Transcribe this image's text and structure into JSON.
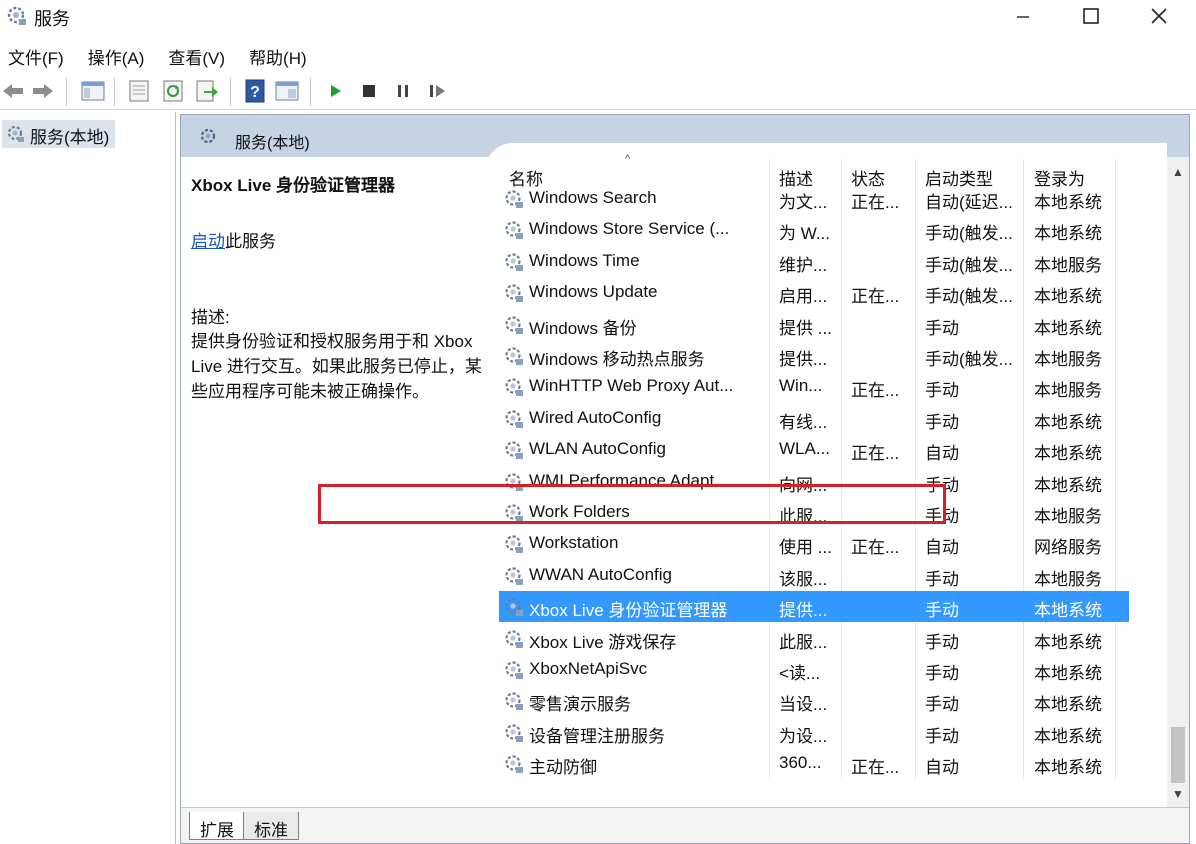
{
  "window": {
    "title": "服务"
  },
  "menu": [
    "文件(F)",
    "操作(A)",
    "查看(V)",
    "帮助(H)"
  ],
  "tree": {
    "root_label": "服务(本地)"
  },
  "pane": {
    "header_title": "服务(本地)",
    "detail": {
      "title": "Xbox Live 身份验证管理器",
      "start_link": "启动",
      "start_suffix": "此服务",
      "desc_label": "描述:",
      "desc_text": "提供身份验证和授权服务用于和 Xbox Live 进行交互。如果此服务已停止，某些应用程序可能未被正确操作。"
    },
    "columns": [
      "名称",
      "描述",
      "状态",
      "启动类型",
      "登录为"
    ],
    "rows": [
      [
        "Windows Search",
        "为文...",
        "正在...",
        "自动(延迟...",
        "本地系统"
      ],
      [
        "Windows Store Service (...",
        "为 W...",
        "",
        "手动(触发...",
        "本地系统"
      ],
      [
        "Windows Time",
        "维护...",
        "",
        "手动(触发...",
        "本地服务"
      ],
      [
        "Windows Update",
        "启用...",
        "正在...",
        "手动(触发...",
        "本地系统"
      ],
      [
        "Windows 备份",
        "提供 ...",
        "",
        "手动",
        "本地系统"
      ],
      [
        "Windows 移动热点服务",
        "提供...",
        "",
        "手动(触发...",
        "本地服务"
      ],
      [
        "WinHTTP Web Proxy Aut...",
        "Win...",
        "正在...",
        "手动",
        "本地服务"
      ],
      [
        "Wired AutoConfig",
        "有线...",
        "",
        "手动",
        "本地系统"
      ],
      [
        "WLAN AutoConfig",
        "WLA...",
        "正在...",
        "自动",
        "本地系统"
      ],
      [
        "WMI Performance Adapt...",
        "向网...",
        "",
        "手动",
        "本地系统"
      ],
      [
        "Work Folders",
        "此服...",
        "",
        "手动",
        "本地服务"
      ],
      [
        "Workstation",
        "使用 ...",
        "正在...",
        "自动",
        "网络服务"
      ],
      [
        "WWAN AutoConfig",
        "该服...",
        "",
        "手动",
        "本地服务"
      ],
      [
        "Xbox Live 身份验证管理器",
        "提供...",
        "",
        "手动",
        "本地系统"
      ],
      [
        "Xbox Live 游戏保存",
        "此服...",
        "",
        "手动",
        "本地系统"
      ],
      [
        "XboxNetApiSvc",
        "<读...",
        "",
        "手动",
        "本地系统"
      ],
      [
        "零售演示服务",
        "当设...",
        "",
        "手动",
        "本地系统"
      ],
      [
        "设备管理注册服务",
        "为设...",
        "",
        "手动",
        "本地系统"
      ],
      [
        "主动防御",
        "360...",
        "正在...",
        "自动",
        "本地系统"
      ]
    ],
    "selected_row": "Xbox Live 身份验证管理器"
  },
  "tabs": [
    "扩展",
    "标准"
  ],
  "colors": {
    "header_bg": "#c5d3e4",
    "selection": "#3399ff",
    "highlight_box": "#d42027",
    "link": "#1a55c6"
  },
  "icons": [
    "services-gear-icon",
    "back-arrow-icon",
    "forward-arrow-icon",
    "console-tree-icon",
    "properties-icon",
    "refresh-icon",
    "export-icon",
    "help-icon",
    "view-icon",
    "play-icon",
    "stop-icon",
    "pause-icon",
    "resume-icon",
    "minimize-icon",
    "maximize-icon",
    "close-icon"
  ]
}
